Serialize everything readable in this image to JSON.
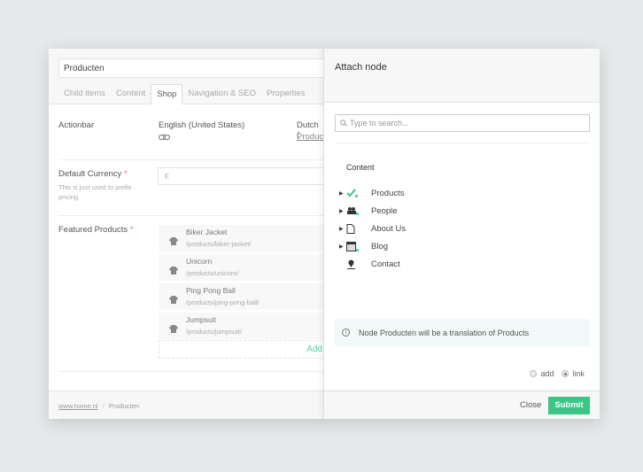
{
  "editor": {
    "title_value": "Producten",
    "tabs": [
      {
        "label": "Child items"
      },
      {
        "label": "Content"
      },
      {
        "label": "Shop",
        "active": true
      },
      {
        "label": "Navigation & SEO"
      },
      {
        "label": "Properties"
      }
    ],
    "actionbar": {
      "label": "Actionbar",
      "lang1": "English (United States)",
      "lang2": "Dutch (",
      "lang2_link": "Produc",
      "link_icon": "link-icon"
    },
    "currency": {
      "label": "Default Currency",
      "required": "*",
      "hint": "This is just used to prefix pricing",
      "value": "€"
    },
    "featured": {
      "label": "Featured Products",
      "required": "*",
      "items": [
        {
          "name": "Biker Jacket",
          "path": "/products/biker-jacket/"
        },
        {
          "name": "Unicorn",
          "path": "/products/unicorn/"
        },
        {
          "name": "Ping Pong Ball",
          "path": "/products/ping-pong-ball/"
        },
        {
          "name": "Jumpsuit",
          "path": "/products/jumpsuit/"
        }
      ],
      "add_label": "Add"
    },
    "breadcrumb": {
      "home": "www.home.nl",
      "separator": "/",
      "current": "Producten"
    }
  },
  "modal": {
    "title": "Attach node",
    "search_placeholder": "Type to search...",
    "tree_root": "Content",
    "nodes": [
      {
        "label": "Products",
        "icon": "checkmark-icon",
        "expandable": true
      },
      {
        "label": "People",
        "icon": "people-icon",
        "expandable": true
      },
      {
        "label": "About Us",
        "icon": "page-icon",
        "expandable": true
      },
      {
        "label": "Blog",
        "icon": "calendar-icon",
        "expandable": true
      },
      {
        "label": "Contact",
        "icon": "map-pin-icon",
        "expandable": false
      }
    ],
    "info": "Node Producten will be a translation of Products",
    "options": [
      {
        "label": "add",
        "selected": false
      },
      {
        "label": "link",
        "selected": true
      }
    ],
    "close_label": "Close",
    "submit_label": "Submit"
  },
  "colors": {
    "accent": "#3cc585",
    "add_link": "#5cd0b0",
    "info_bg": "#f0f9f7",
    "required": "#ee7777"
  }
}
